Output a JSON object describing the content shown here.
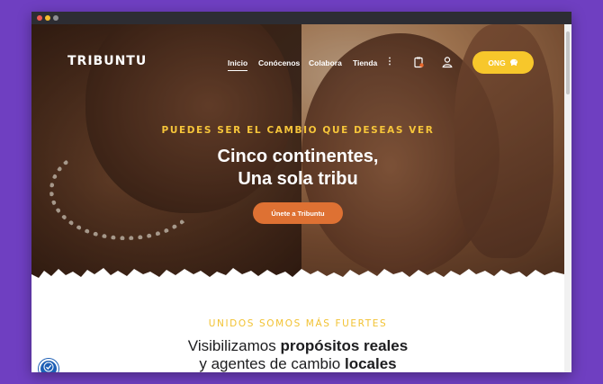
{
  "window": {
    "traffic_lights": [
      "close",
      "minimize",
      "zoom"
    ]
  },
  "brand": {
    "logo_text": "TRIBUNTU"
  },
  "nav": {
    "items": [
      {
        "label": "Inicio",
        "active": true
      },
      {
        "label": "Conócenos",
        "active": false
      },
      {
        "label": "Colabora",
        "active": false
      },
      {
        "label": "Tienda",
        "active": false
      }
    ],
    "more": "⋮",
    "ong_button": "ONG"
  },
  "icons": {
    "cart": "clipboard-cart-icon",
    "user": "user-icon",
    "piggy": "piggy-bank-icon",
    "accessibility": "accessibility-icon"
  },
  "hero": {
    "tagline": "PUEDES SER EL CAMBIO QUE DESEAS VER",
    "headline_line1": "Cinco continentes,",
    "headline_line2": "Una sola tribu",
    "cta_label": "Únete a Tribuntu"
  },
  "section": {
    "title": "UNIDOS SOMOS MÁS FUERTES",
    "text_line1_plain": "Visibilizamos ",
    "text_line1_bold": "propósitos reales",
    "text_line2_plain": "y agentes de cambio ",
    "text_line2_bold": "locales"
  },
  "colors": {
    "background": "#6f3fc1",
    "accent_yellow": "#f7c72b",
    "cta_orange": "#de7133",
    "tagline_yellow": "#f6c53a",
    "a11y_blue": "#1d5fb5"
  }
}
